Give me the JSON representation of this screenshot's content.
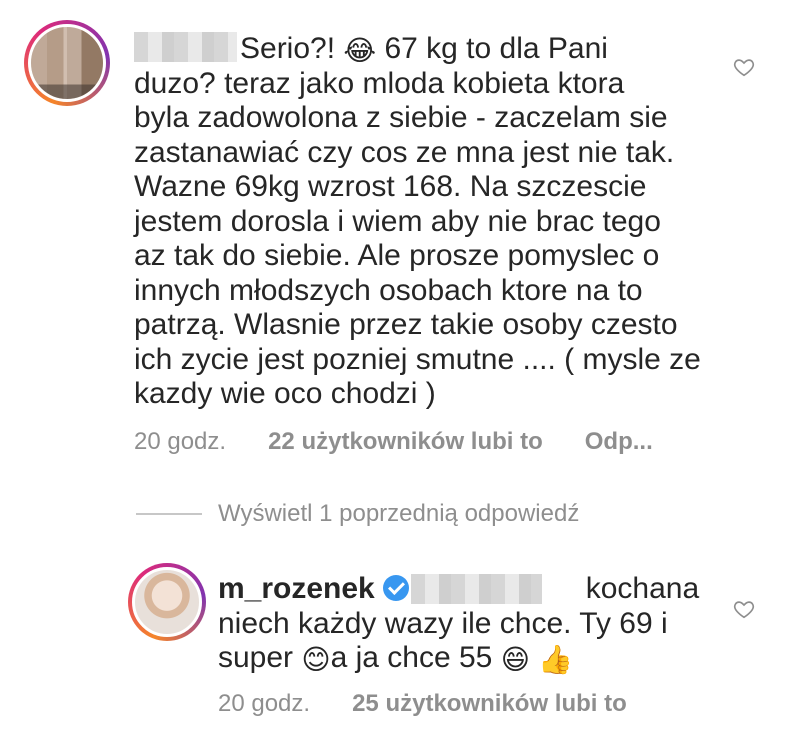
{
  "comment": {
    "text_lead": "Serio?! ",
    "emoji_1": "😂",
    "text_body": " 67 kg to dla Pani\nduzo? teraz jako mloda kobieta ktora\nbyla zadowolona z siebie - zaczelam sie\nzastanawiać czy cos ze mna jest nie tak.\nWazne 69kg wzrost 168. Na szczescie\njestem dorosla i wiem aby nie brac tego\naz tak do siebie. Ale prosze pomyslec o\ninnych młodszych osobach ktore na to\npatrzą. Wlasnie przez takie osoby czesto\nich zycie jest pozniej smutne .... ( mysle ze\nkazdy wie oco chodzi )",
    "time": "20 godz.",
    "likes": "22 użytkowników lubi to",
    "reply": "Odp..."
  },
  "view_previous": {
    "label": "Wyświetl 1 poprzednią odpowiedź"
  },
  "reply": {
    "username": "m_rozenek",
    "text_lead": "kochana\nniech każdy wazy ile chce. Ty 69 i\nsuper ",
    "emoji_1": "😊",
    "text_mid": "a ja chce 55 ",
    "emoji_2": "😄",
    "emoji_3": "👍",
    "time": "20 godz.",
    "likes": "25 użytkowników lubi to"
  },
  "icons": {
    "heart": "heart-outline-icon",
    "verified": "verified-badge-icon"
  },
  "colors": {
    "text": "#262626",
    "meta": "#8e8e8e",
    "verified": "#3897f0"
  }
}
